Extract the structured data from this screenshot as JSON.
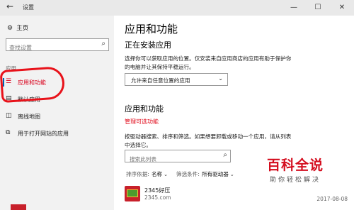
{
  "window": {
    "title": "设置",
    "controls": [
      "—",
      "☐",
      "✕"
    ]
  },
  "sidebar": {
    "home_label": "主页",
    "search_placeholder": "查找设置",
    "section_label": "应用",
    "items": [
      {
        "label": "应用和功能",
        "icon": "list-icon",
        "active": true
      },
      {
        "label": "默认应用",
        "icon": "default-apps-icon",
        "active": false
      },
      {
        "label": "离线地图",
        "icon": "map-icon",
        "active": false
      },
      {
        "label": "用于打开网站的应用",
        "icon": "web-apps-icon",
        "active": false
      }
    ]
  },
  "main": {
    "title": "应用和功能",
    "install": {
      "heading": "正在安装应用",
      "description": "选择你可以获取应用的位置。仅安装来自应用商店的应用有助于保护你的电脑并让其保持平稳运行。",
      "dropdown_value": "允许来自任意位置的应用"
    },
    "apps": {
      "heading": "应用和功能",
      "manage_link": "管理可选功能",
      "description": "按驱动器搜索、排序和筛选。如果想要卸载或移动一个应用，请从列表中选择它。",
      "search_placeholder": "搜索此列表",
      "sort_label": "排序依据:",
      "sort_value": "名称",
      "filter_label": "筛选条件:",
      "filter_value": "所有驱动器",
      "list": [
        {
          "name": "2345好压",
          "publisher": "2345.com",
          "date": "2017-08-08"
        }
      ]
    }
  },
  "watermark": {
    "main": "百科全说",
    "sub": "助你轻松解决"
  },
  "colors": {
    "accent_red": "#d9001b",
    "annotation_red": "#e8121a",
    "sidebar_bg": "#f2f2f2"
  }
}
